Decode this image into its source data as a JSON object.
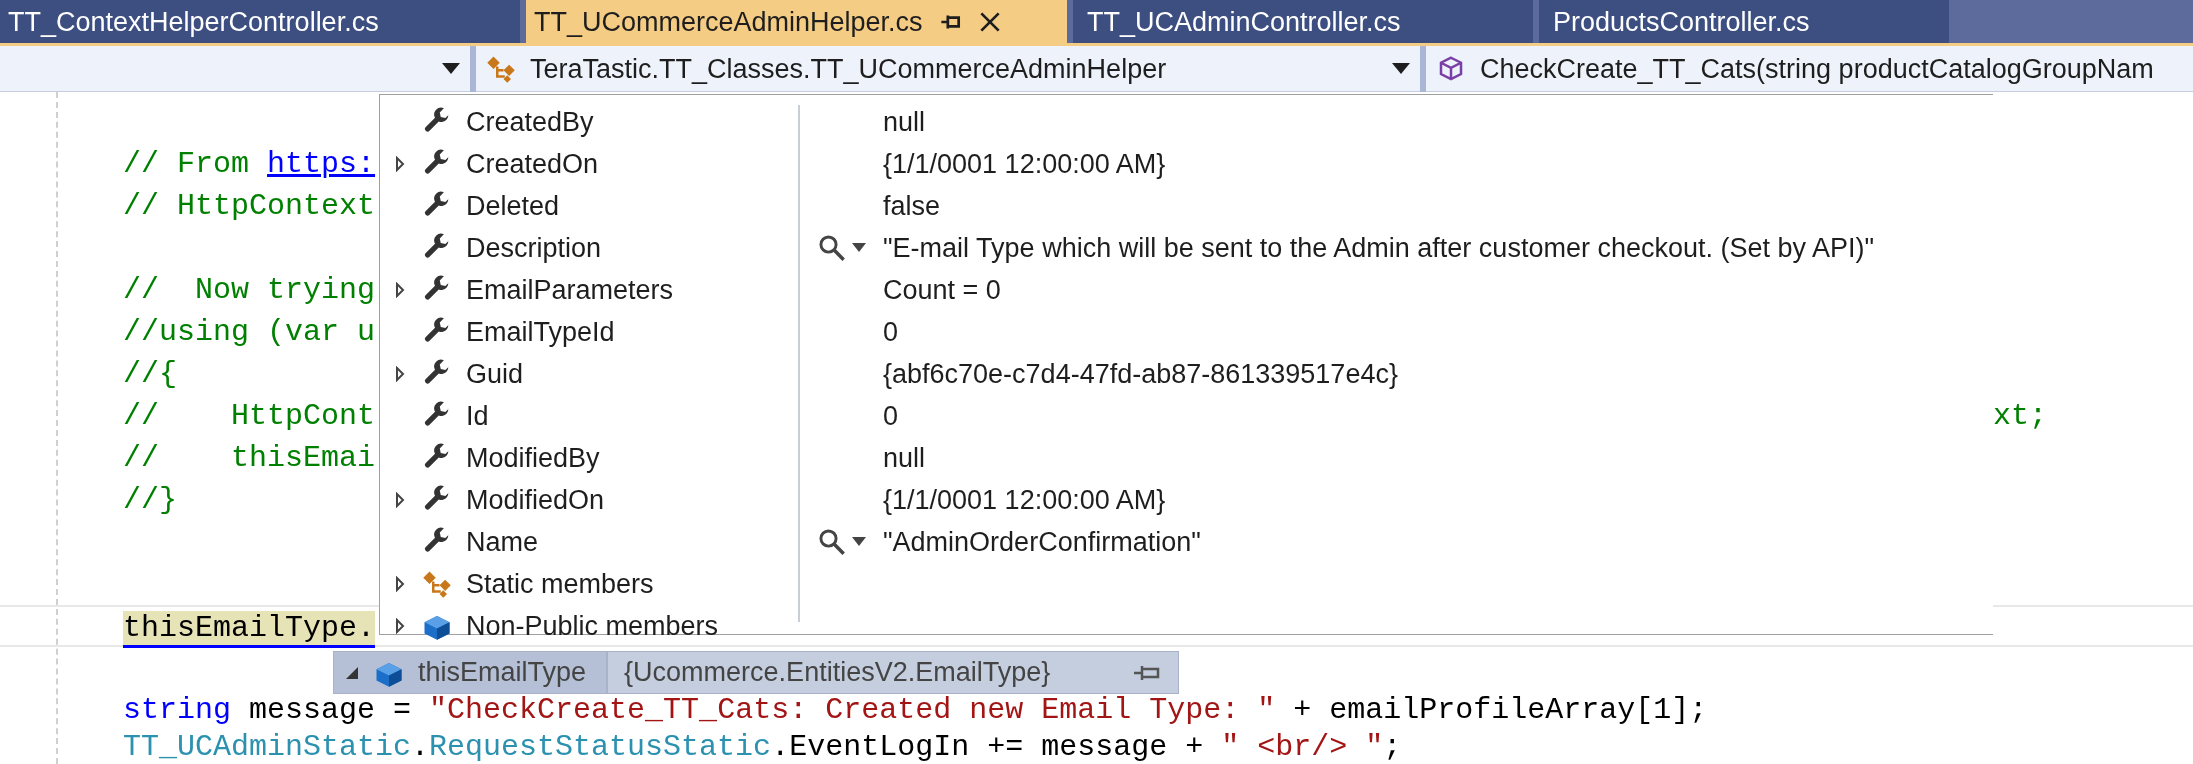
{
  "tabs": [
    {
      "label": "TT_ContextHelperController.cs",
      "selected": false
    },
    {
      "label": "TT_UCommerceAdminHelper.cs",
      "selected": true
    },
    {
      "label": "TT_UCAdminController.cs",
      "selected": false
    },
    {
      "label": "ProductsController.cs",
      "selected": false
    }
  ],
  "navigation_bar": [
    {
      "kind": "empty"
    },
    {
      "kind": "class",
      "text": "TeraTastic.TT_Classes.TT_UCommerceAdminHelper"
    },
    {
      "kind": "method",
      "text": "CheckCreate_TT_Cats(string productCatalogGroupNam"
    }
  ],
  "code_lines": [
    {
      "kind": "code",
      "segments": [
        {
          "kind": "comment",
          "text": "// From "
        },
        {
          "kind": "link",
          "text": "https:"
        }
      ]
    },
    {
      "kind": "code",
      "segments": [
        {
          "kind": "comment",
          "text": "// HttpContext"
        }
      ]
    },
    {
      "kind": "blank"
    },
    {
      "kind": "code",
      "segments": [
        {
          "kind": "comment",
          "text": "//  Now trying"
        }
      ]
    },
    {
      "kind": "code",
      "segments": [
        {
          "kind": "comment",
          "text": "//using (var u"
        }
      ]
    },
    {
      "kind": "code",
      "segments": [
        {
          "kind": "comment",
          "text": "//{"
        }
      ]
    },
    {
      "kind": "code",
      "segments": [
        {
          "kind": "comment",
          "text": "//    HttpCont"
        }
      ],
      "tail": {
        "kind": "comment",
        "text": "xt;"
      }
    },
    {
      "kind": "code",
      "segments": [
        {
          "kind": "comment",
          "text": "//    thisEmai"
        }
      ]
    },
    {
      "kind": "code",
      "segments": [
        {
          "kind": "comment",
          "text": "//}"
        }
      ]
    },
    {
      "kind": "blank"
    },
    {
      "kind": "blank"
    },
    {
      "kind": "code",
      "segments": [
        {
          "kind": "highlight",
          "text": "thisEmailType."
        }
      ],
      "current": true
    },
    {
      "kind": "blank"
    },
    {
      "kind": "code",
      "segments": [
        {
          "kind": "keyword",
          "text": "string"
        },
        {
          "kind": "plain",
          "text": " message = "
        },
        {
          "kind": "string",
          "text": "\"CheckCreate_TT_Cats: Created new Email Type: \""
        },
        {
          "kind": "plain",
          "text": " + emailProfileArray[1];"
        }
      ]
    },
    {
      "kind": "code",
      "segments": [
        {
          "kind": "type",
          "text": "TT_UCAdminStatic"
        },
        {
          "kind": "plain",
          "text": "."
        },
        {
          "kind": "type",
          "text": "RequestStatusStatic"
        },
        {
          "kind": "plain",
          "text": ".EventLogIn += message + "
        },
        {
          "kind": "string",
          "text": "\" <br/> \""
        },
        {
          "kind": "plain",
          "text": ";"
        }
      ]
    }
  ],
  "watch_popup": {
    "rows": [
      {
        "name": "CreatedBy",
        "kind": "property",
        "expandable": false,
        "value": "null",
        "visualizer": false
      },
      {
        "name": "CreatedOn",
        "kind": "property",
        "expandable": true,
        "value": "{1/1/0001 12:00:00 AM}",
        "visualizer": false
      },
      {
        "name": "Deleted",
        "kind": "property",
        "expandable": false,
        "value": "false",
        "visualizer": false
      },
      {
        "name": "Description",
        "kind": "property",
        "expandable": false,
        "value": "\"E-mail Type which will be sent to the Admin after customer checkout. (Set by API)\"",
        "visualizer": true
      },
      {
        "name": "EmailParameters",
        "kind": "property",
        "expandable": true,
        "value": "Count = 0",
        "visualizer": false
      },
      {
        "name": "EmailTypeId",
        "kind": "property",
        "expandable": false,
        "value": "0",
        "visualizer": false
      },
      {
        "name": "Guid",
        "kind": "property",
        "expandable": true,
        "value": "{abf6c70e-c7d4-47fd-ab87-861339517e4c}",
        "visualizer": false
      },
      {
        "name": "Id",
        "kind": "property",
        "expandable": false,
        "value": "0",
        "visualizer": false
      },
      {
        "name": "ModifiedBy",
        "kind": "property",
        "expandable": false,
        "value": "null",
        "visualizer": false
      },
      {
        "name": "ModifiedOn",
        "kind": "property",
        "expandable": true,
        "value": "{1/1/0001 12:00:00 AM}",
        "visualizer": false
      },
      {
        "name": "Name",
        "kind": "property",
        "expandable": false,
        "value": "\"AdminOrderConfirmation\"",
        "visualizer": true
      },
      {
        "name": "Static members",
        "kind": "static",
        "expandable": true,
        "visualizer": false
      },
      {
        "name": "Non-Public members",
        "kind": "nonpublic",
        "expandable": true,
        "visualizer": false
      }
    ]
  },
  "datatip": {
    "name": "thisEmailType",
    "value": "{Ucommerce.EntitiesV2.EmailType}",
    "expanded": true
  }
}
